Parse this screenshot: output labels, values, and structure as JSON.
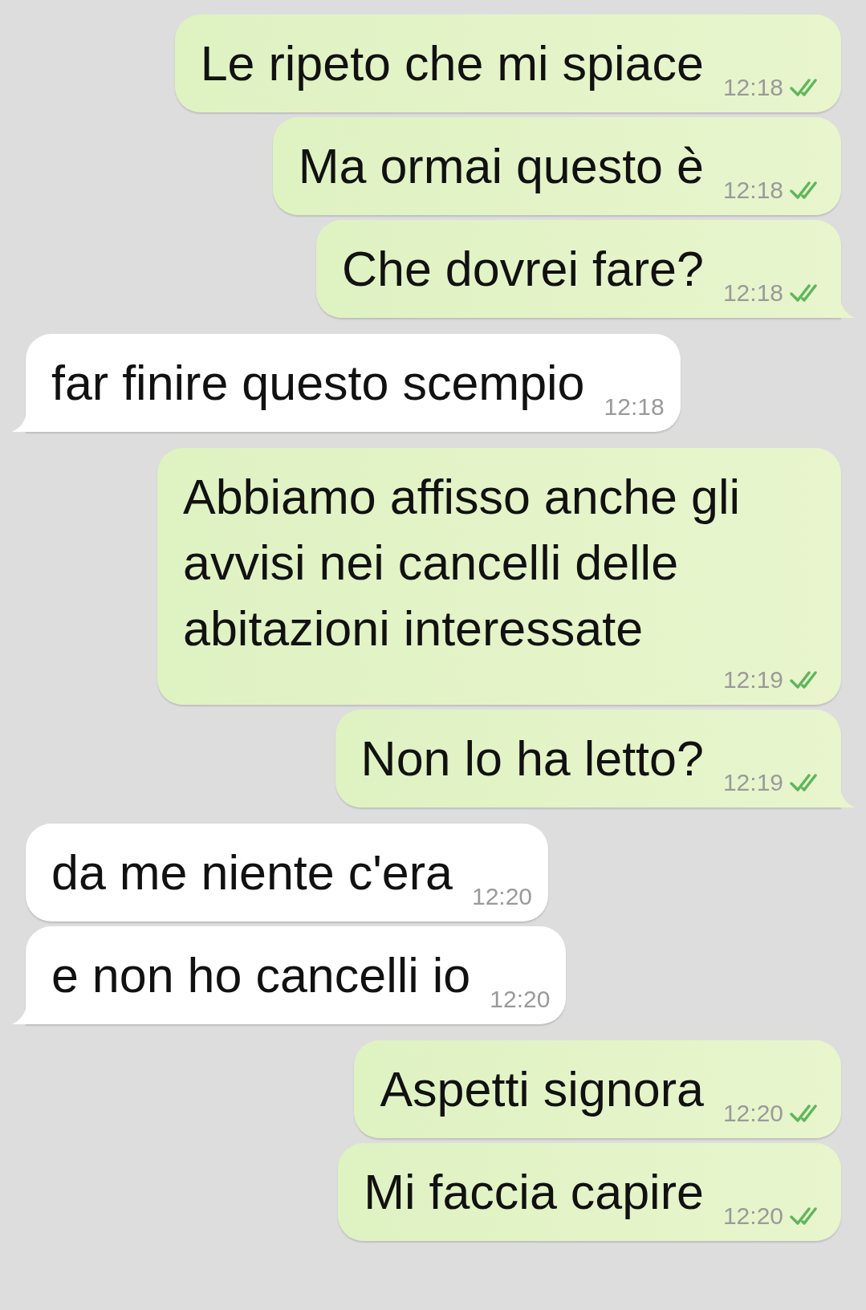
{
  "messages": [
    {
      "kind": "outgoing",
      "text": "Le ripeto che mi spiace",
      "time": "12:18",
      "delivered": true,
      "tail": false
    },
    {
      "kind": "outgoing",
      "text": "Ma ormai questo è",
      "time": "12:18",
      "delivered": true,
      "tail": false
    },
    {
      "kind": "outgoing",
      "text": "Che dovrei fare?",
      "time": "12:18",
      "delivered": true,
      "tail": true
    },
    {
      "kind": "incoming",
      "text": "far finire questo scempio",
      "time": "12:18",
      "tail": true
    },
    {
      "kind": "outgoing",
      "text": "Abbiamo affisso anche gli avvisi nei cancelli delle abitazioni interessate",
      "time": "12:19",
      "delivered": true,
      "tail": false
    },
    {
      "kind": "outgoing",
      "text": "Non lo ha letto?",
      "time": "12:19",
      "delivered": true,
      "tail": true
    },
    {
      "kind": "incoming",
      "text": "da me niente c'era",
      "time": "12:20",
      "tail": false
    },
    {
      "kind": "incoming",
      "text": "e non ho cancelli io",
      "time": "12:20",
      "tail": true
    },
    {
      "kind": "outgoing",
      "text": "Aspetti signora",
      "time": "12:20",
      "delivered": true,
      "tail": false
    },
    {
      "kind": "outgoing",
      "text": "Mi faccia capire",
      "time": "12:20",
      "delivered": true,
      "tail": false
    }
  ]
}
